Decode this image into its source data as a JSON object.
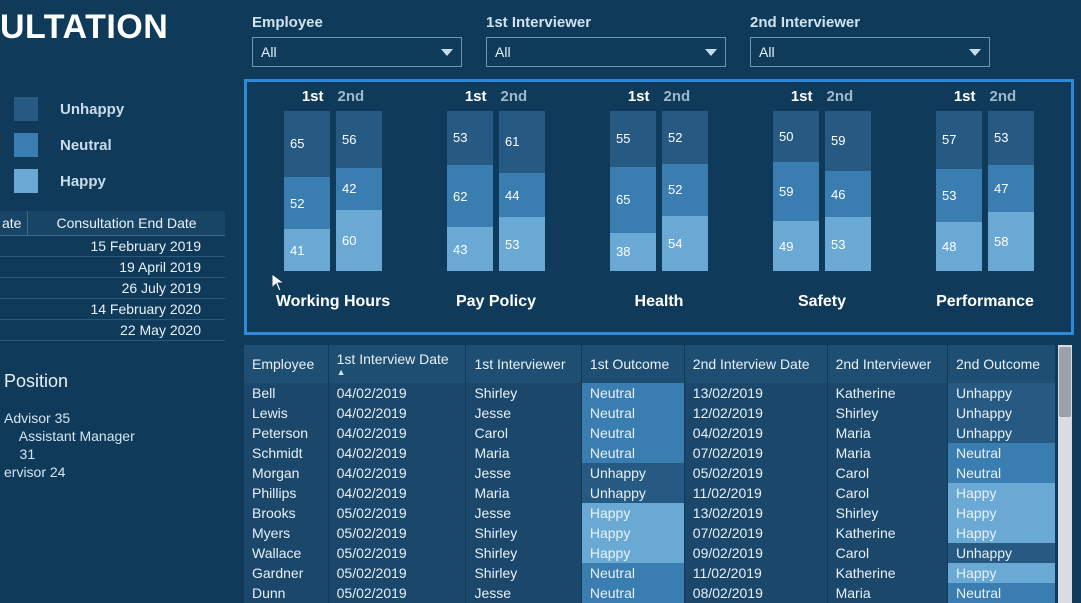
{
  "title": "ULTATION",
  "legend": {
    "unhappy": "Unhappy",
    "neutral": "Neutral",
    "happy": "Happy"
  },
  "dates_header": {
    "col1": "ate",
    "col2": "Consultation End Date"
  },
  "dates": [
    "15 February 2019",
    "19 April 2019",
    "26 July 2019",
    "14 February 2020",
    "22 May 2020"
  ],
  "position_title": "Position",
  "positions": [
    "Advisor 35",
    "",
    "    Assistant Manager",
    "    31",
    "ervisor 24"
  ],
  "filters": {
    "employee": {
      "label": "Employee",
      "value": "All"
    },
    "int1": {
      "label": "1st Interviewer",
      "value": "All"
    },
    "int2": {
      "label": "2nd Interviewer",
      "value": "All"
    }
  },
  "chart_data": [
    {
      "name": "Working Hours",
      "h1": "1st",
      "h2": "2nd",
      "s1": {
        "unhappy": 65,
        "neutral": 52,
        "happy": 41
      },
      "s2": {
        "unhappy": 56,
        "neutral": 42,
        "happy": 60
      }
    },
    {
      "name": "Pay Policy",
      "h1": "1st",
      "h2": "2nd",
      "s1": {
        "unhappy": 53,
        "neutral": 62,
        "happy": 43
      },
      "s2": {
        "unhappy": 61,
        "neutral": 44,
        "happy": 53
      }
    },
    {
      "name": "Health",
      "h1": "1st",
      "h2": "2nd",
      "s1": {
        "unhappy": 55,
        "neutral": 65,
        "happy": 38
      },
      "s2": {
        "unhappy": 52,
        "neutral": 52,
        "happy": 54
      }
    },
    {
      "name": "Safety",
      "h1": "1st",
      "h2": "2nd",
      "s1": {
        "unhappy": 50,
        "neutral": 59,
        "happy": 49
      },
      "s2": {
        "unhappy": 59,
        "neutral": 46,
        "happy": 53
      }
    },
    {
      "name": "Performance",
      "h1": "1st",
      "h2": "2nd",
      "s1": {
        "unhappy": 57,
        "neutral": 53,
        "happy": 48
      },
      "s2": {
        "unhappy": 53,
        "neutral": 47,
        "happy": 58
      }
    }
  ],
  "table": {
    "headers": [
      "Employee",
      "1st Interview Date",
      "1st Interviewer",
      "1st Outcome",
      "2nd Interview Date",
      "2nd Interviewer",
      "2nd Outcome"
    ],
    "rows": [
      {
        "emp": "Bell",
        "d1": "04/02/2019",
        "i1": "Shirley",
        "o1": "Neutral",
        "d2": "13/02/2019",
        "i2": "Katherine",
        "o2": "Unhappy"
      },
      {
        "emp": "Lewis",
        "d1": "04/02/2019",
        "i1": "Jesse",
        "o1": "Neutral",
        "d2": "12/02/2019",
        "i2": "Shirley",
        "o2": "Unhappy"
      },
      {
        "emp": "Peterson",
        "d1": "04/02/2019",
        "i1": "Carol",
        "o1": "Neutral",
        "d2": "04/02/2019",
        "i2": "Maria",
        "o2": "Unhappy"
      },
      {
        "emp": "Schmidt",
        "d1": "04/02/2019",
        "i1": "Maria",
        "o1": "Neutral",
        "d2": "07/02/2019",
        "i2": "Maria",
        "o2": "Neutral"
      },
      {
        "emp": "Morgan",
        "d1": "04/02/2019",
        "i1": "Jesse",
        "o1": "Unhappy",
        "d2": "05/02/2019",
        "i2": "Carol",
        "o2": "Neutral"
      },
      {
        "emp": "Phillips",
        "d1": "04/02/2019",
        "i1": "Maria",
        "o1": "Unhappy",
        "d2": "11/02/2019",
        "i2": "Carol",
        "o2": "Happy"
      },
      {
        "emp": "Brooks",
        "d1": "05/02/2019",
        "i1": "Jesse",
        "o1": "Happy",
        "d2": "13/02/2019",
        "i2": "Shirley",
        "o2": "Happy"
      },
      {
        "emp": "Myers",
        "d1": "05/02/2019",
        "i1": "Shirley",
        "o1": "Happy",
        "d2": "07/02/2019",
        "i2": "Katherine",
        "o2": "Happy"
      },
      {
        "emp": "Wallace",
        "d1": "05/02/2019",
        "i1": "Shirley",
        "o1": "Happy",
        "d2": "09/02/2019",
        "i2": "Carol",
        "o2": "Unhappy"
      },
      {
        "emp": "Gardner",
        "d1": "05/02/2019",
        "i1": "Shirley",
        "o1": "Neutral",
        "d2": "11/02/2019",
        "i2": "Katherine",
        "o2": "Happy"
      },
      {
        "emp": "Dunn",
        "d1": "05/02/2019",
        "i1": "Jesse",
        "o1": "Neutral",
        "d2": "08/02/2019",
        "i2": "Maria",
        "o2": "Neutral"
      }
    ]
  }
}
